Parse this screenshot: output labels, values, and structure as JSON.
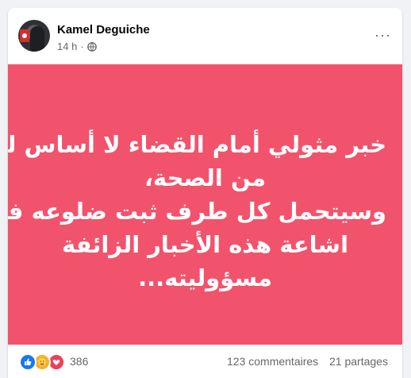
{
  "post": {
    "author": "Kamel Deguiche",
    "timestamp": "14 h",
    "separator": "·",
    "privacy_icon": "globe-icon",
    "more_label": "···",
    "background_color": "#f2536c",
    "text_lines": [
      "خبر مثولي أمام القضاء لا أساس له",
      "من الصحة،",
      "وسيتحمل كل طرف ثبت ضلوعه في",
      "اشاعة هذه الأخبار الزائفة",
      "مسؤوليته..."
    ]
  },
  "footer": {
    "reaction_icons": [
      "like-icon",
      "care-icon",
      "love-icon"
    ],
    "reaction_count": "386",
    "comments": "123 commentaires",
    "shares": "21 partages"
  }
}
